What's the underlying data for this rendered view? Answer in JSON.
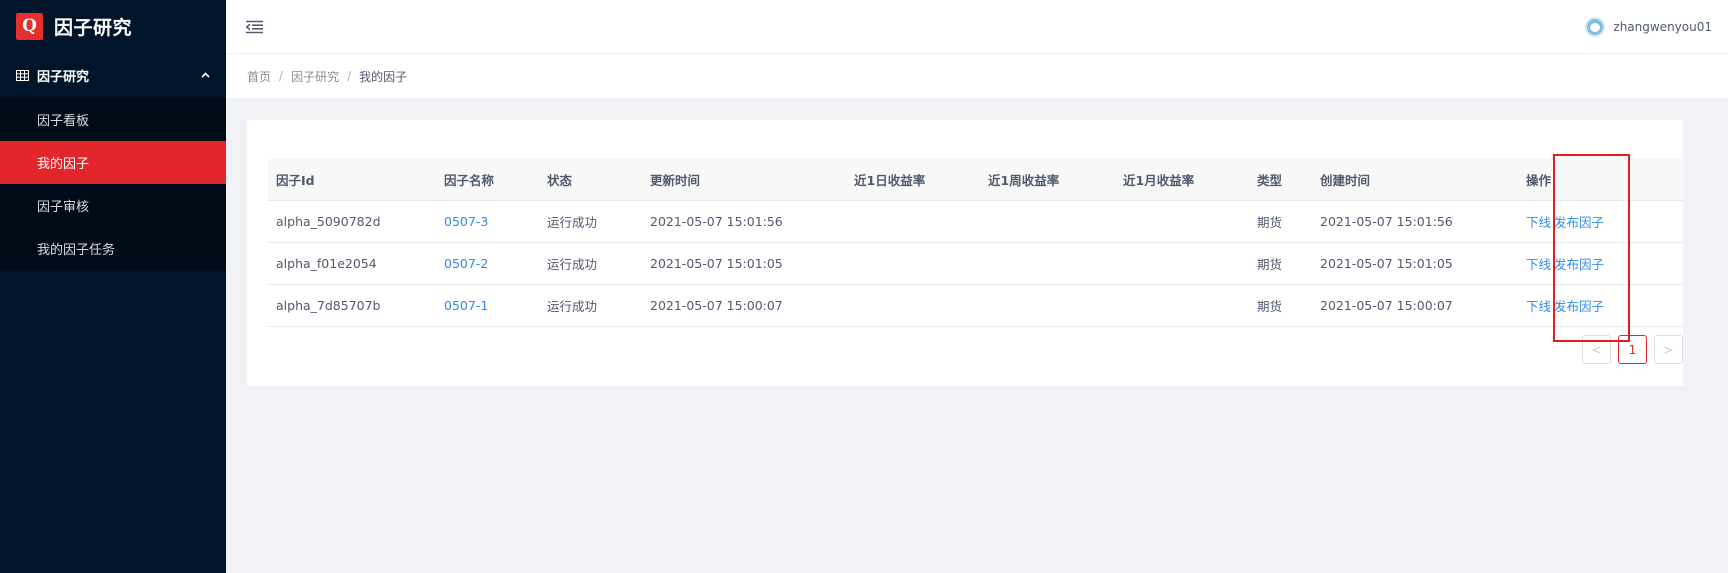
{
  "app": {
    "logo_letter": "Q",
    "title": "因子研究"
  },
  "sidebar": {
    "group": {
      "label": "因子研究",
      "icon": "grid-icon",
      "expanded": true
    },
    "items": [
      {
        "label": "因子看板",
        "active": false
      },
      {
        "label": "我的因子",
        "active": true
      },
      {
        "label": "因子审核",
        "active": false
      },
      {
        "label": "我的因子任务",
        "active": false
      }
    ]
  },
  "header": {
    "fold_icon": "menu-fold-icon",
    "username": "zhangwenyou01"
  },
  "breadcrumb": [
    "首页",
    "因子研究",
    "我的因子"
  ],
  "table": {
    "columns": [
      "因子Id",
      "因子名称",
      "状态",
      "更新时间",
      "近1日收益率",
      "近1周收益率",
      "近1月收益率",
      "类型",
      "创建时间",
      "操作"
    ],
    "rows": [
      {
        "id": "alpha_5090782d",
        "name": "0507-3",
        "status": "运行成功",
        "updated": "2021-05-07 15:01:56",
        "r1d": "",
        "r1w": "",
        "r1m": "",
        "type": "期货",
        "created": "2021-05-07 15:01:56",
        "op1": "下线",
        "op2": "发布因子"
      },
      {
        "id": "alpha_f01e2054",
        "name": "0507-2",
        "status": "运行成功",
        "updated": "2021-05-07 15:01:05",
        "r1d": "",
        "r1w": "",
        "r1m": "",
        "type": "期货",
        "created": "2021-05-07 15:01:05",
        "op1": "下线",
        "op2": "发布因子"
      },
      {
        "id": "alpha_7d85707b",
        "name": "0507-1",
        "status": "运行成功",
        "updated": "2021-05-07 15:00:07",
        "r1d": "",
        "r1w": "",
        "r1m": "",
        "type": "期货",
        "created": "2021-05-07 15:00:07",
        "op1": "下线",
        "op2": "发布因子"
      }
    ]
  },
  "pagination": {
    "prev": "<",
    "current": "1",
    "next": ">"
  },
  "colors": {
    "brand": "#e3262b",
    "link": "#2d8cf0",
    "sidebar_bg": "#001529",
    "annotation": "#e51c1c"
  }
}
